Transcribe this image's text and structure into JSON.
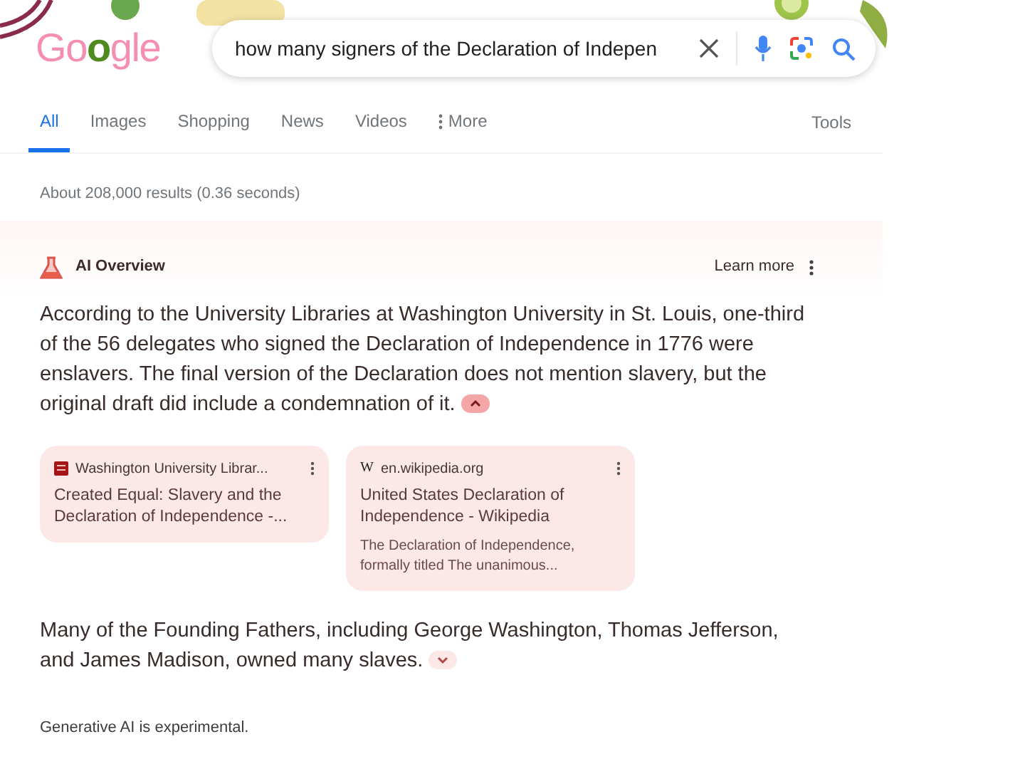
{
  "logo": "Google",
  "search": {
    "value": "how many signers of the Declaration of Indepen"
  },
  "tabs": [
    {
      "label": "All",
      "selected": true
    },
    {
      "label": "Images",
      "selected": false
    },
    {
      "label": "Shopping",
      "selected": false
    },
    {
      "label": "News",
      "selected": false
    },
    {
      "label": "Videos",
      "selected": false
    },
    {
      "label": "More",
      "selected": false
    }
  ],
  "tools": "Tools",
  "result_stats": "About 208,000 results (0.36 seconds)",
  "ai_overview": {
    "title": "AI Overview",
    "learn_more": "Learn more",
    "paragraphs": [
      {
        "text": "According to the University Libraries at Washington University in St. Louis, one-third of the 56 delegates who signed the Declaration of Independence in 1776 were enslavers. The final version of the Declaration does not mention slavery, but the original draft did include a condemnation of it.",
        "expanded": true
      },
      {
        "text": "Many of the Founding Fathers, including George Washington, Thomas Jefferson, and James Madison, owned many slaves.",
        "expanded": false
      }
    ],
    "sources": [
      {
        "kind": "library",
        "site": "Washington University Librar...",
        "title": "Created Equal: Slavery and the Declaration of Independence -..."
      },
      {
        "kind": "wiki",
        "icon": "W",
        "site": "en.wikipedia.org",
        "title": "United States Declaration of Independence - Wikipedia",
        "snippet": "The Declaration of Independence, formally titled The unanimous..."
      }
    ],
    "footer": "Generative AI is experimental."
  }
}
